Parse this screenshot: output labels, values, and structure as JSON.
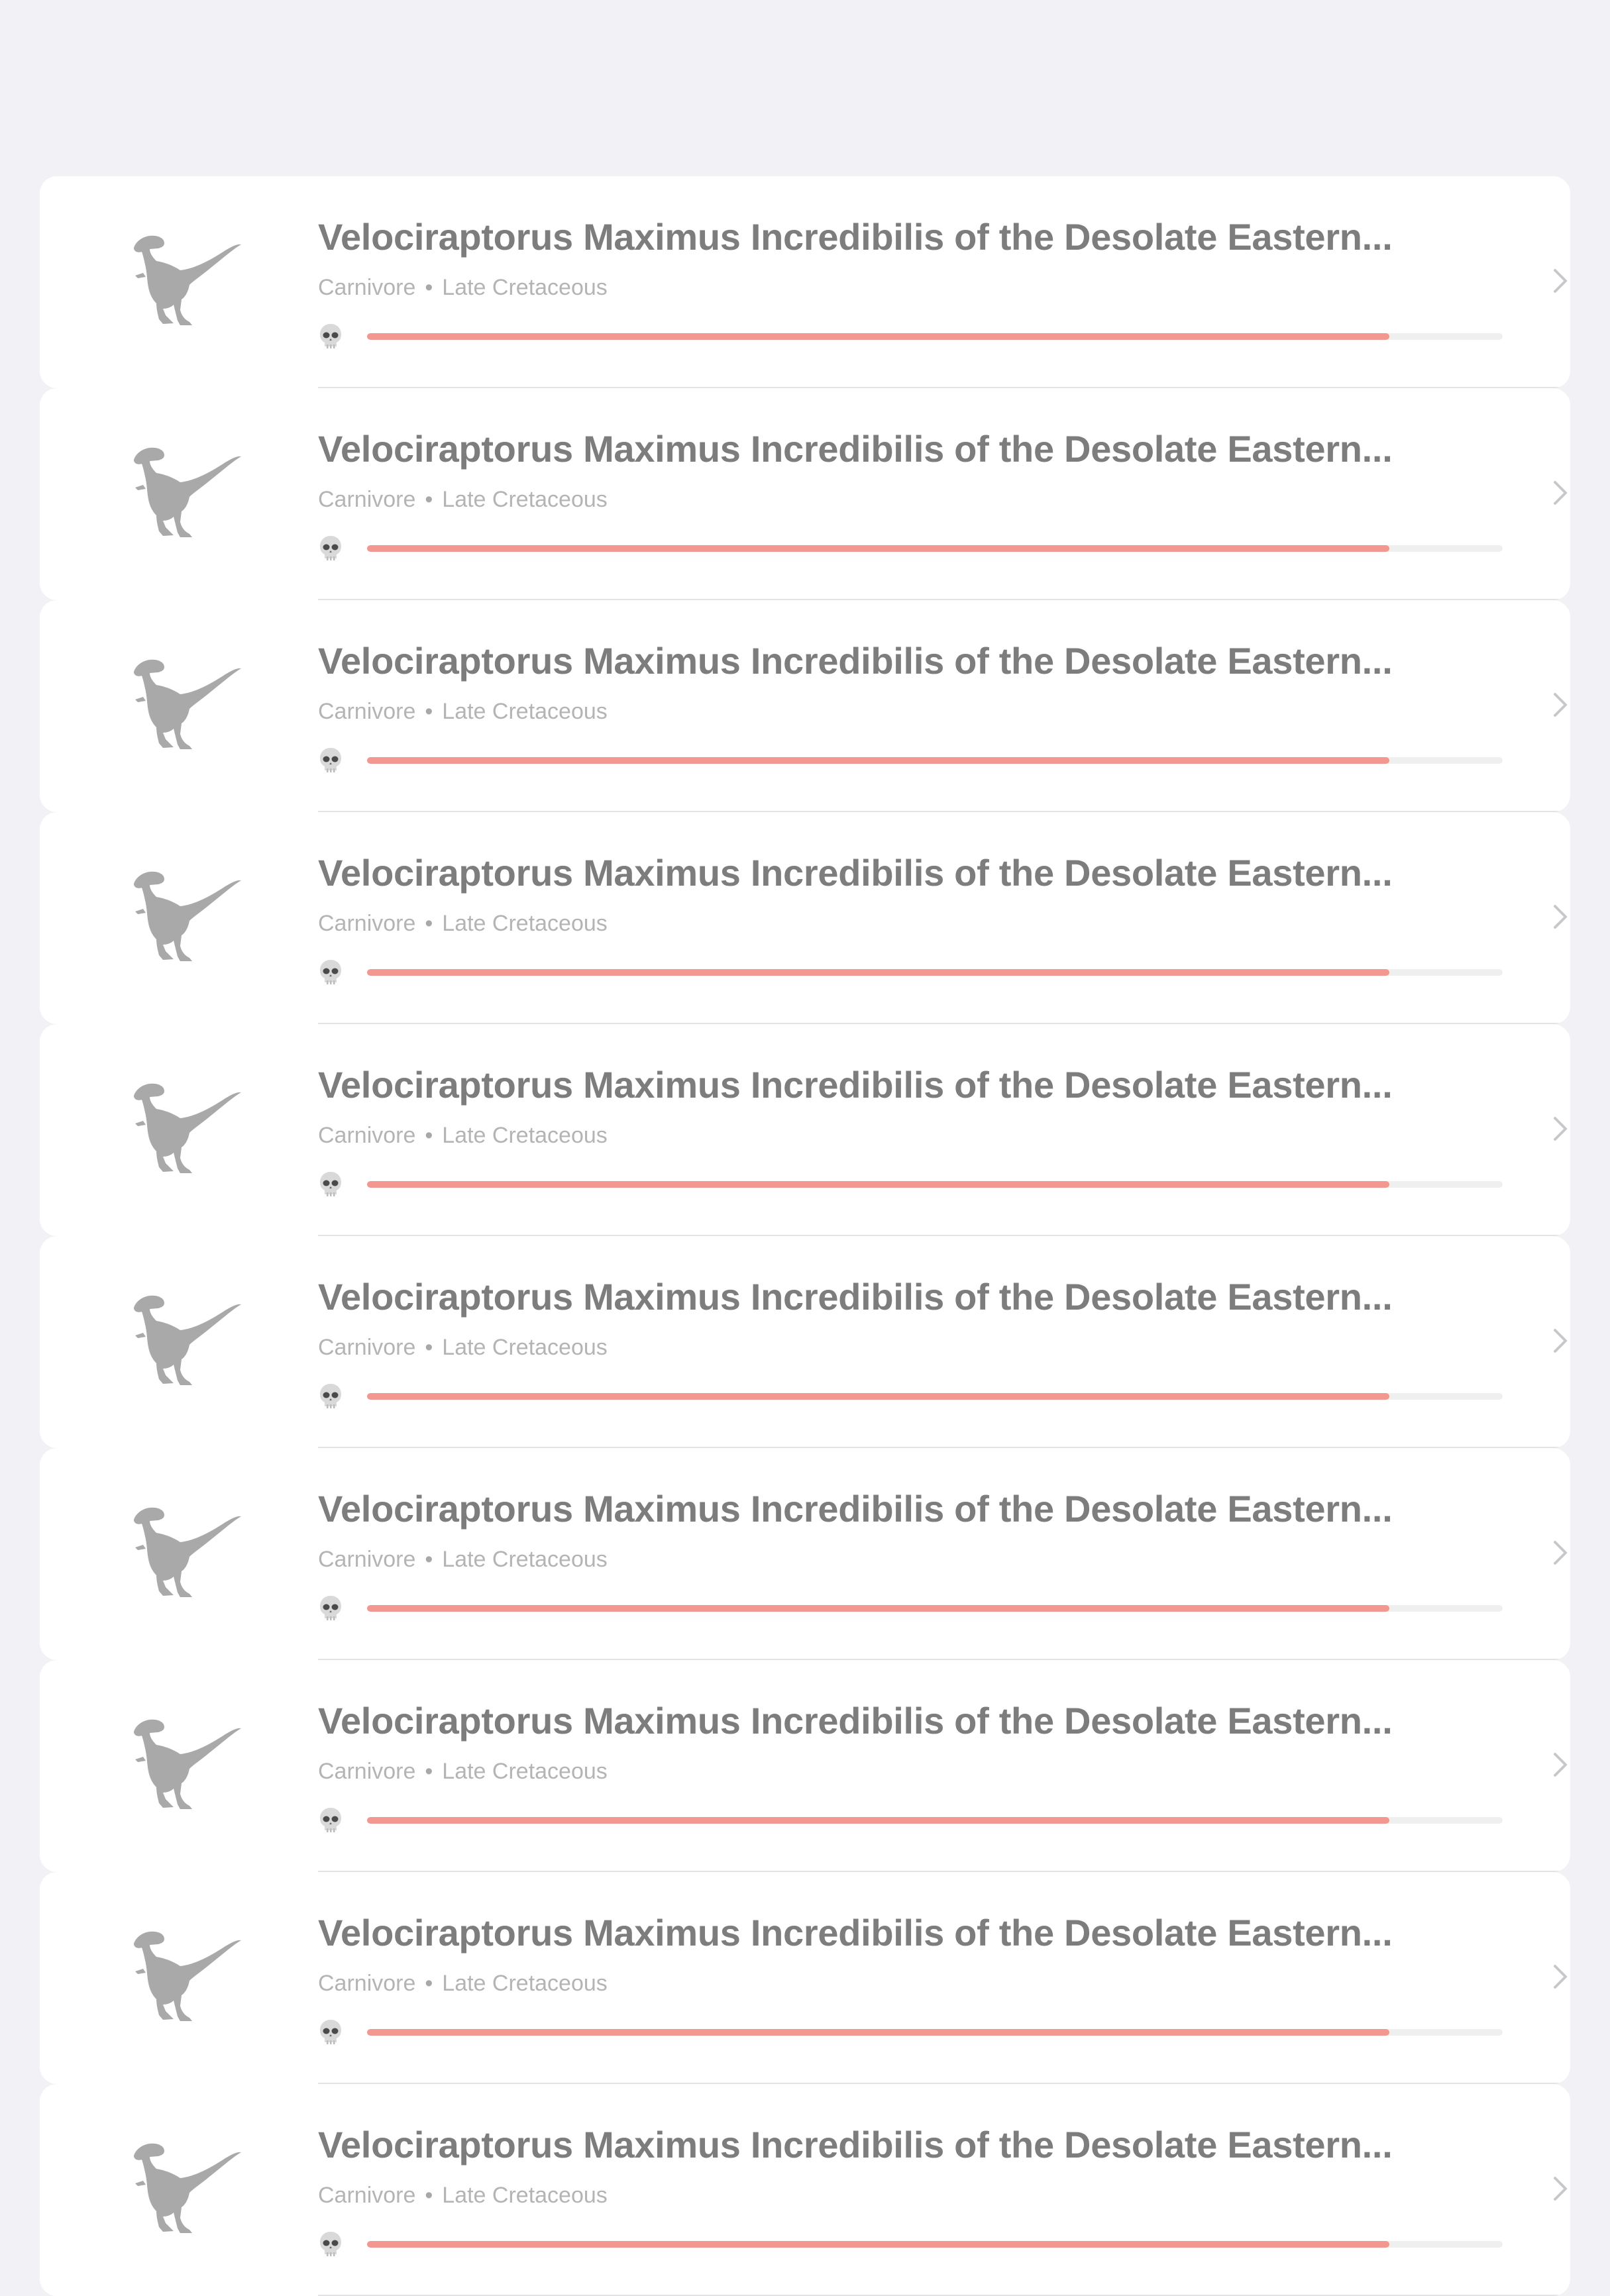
{
  "colors": {
    "background": "#f2f2f6",
    "card": "#ffffff",
    "title": "#7d7d7d",
    "meta": "#b4b4b4",
    "progress_fill": "#f29890",
    "progress_track": "#efefef",
    "icon": "#a9a9a9"
  },
  "list": {
    "items": [
      {
        "title": "Velociraptorus Maximus Incredibilis of the Desolate Eastern...",
        "diet": "Carnivore",
        "separator": "•",
        "period": "Late Cretaceous",
        "danger_fraction": 0.9,
        "thumbnail_icon": "raptor-icon",
        "danger_icon": "skull-icon",
        "disclosure_icon": "chevron-right-icon"
      },
      {
        "title": "Velociraptorus Maximus Incredibilis of the Desolate Eastern...",
        "diet": "Carnivore",
        "separator": "•",
        "period": "Late Cretaceous",
        "danger_fraction": 0.9,
        "thumbnail_icon": "raptor-icon",
        "danger_icon": "skull-icon",
        "disclosure_icon": "chevron-right-icon"
      },
      {
        "title": "Velociraptorus Maximus Incredibilis of the Desolate Eastern...",
        "diet": "Carnivore",
        "separator": "•",
        "period": "Late Cretaceous",
        "danger_fraction": 0.9,
        "thumbnail_icon": "raptor-icon",
        "danger_icon": "skull-icon",
        "disclosure_icon": "chevron-right-icon"
      },
      {
        "title": "Velociraptorus Maximus Incredibilis of the Desolate Eastern...",
        "diet": "Carnivore",
        "separator": "•",
        "period": "Late Cretaceous",
        "danger_fraction": 0.9,
        "thumbnail_icon": "raptor-icon",
        "danger_icon": "skull-icon",
        "disclosure_icon": "chevron-right-icon"
      },
      {
        "title": "Velociraptorus Maximus Incredibilis of the Desolate Eastern...",
        "diet": "Carnivore",
        "separator": "•",
        "period": "Late Cretaceous",
        "danger_fraction": 0.9,
        "thumbnail_icon": "raptor-icon",
        "danger_icon": "skull-icon",
        "disclosure_icon": "chevron-right-icon"
      },
      {
        "title": "Velociraptorus Maximus Incredibilis of the Desolate Eastern...",
        "diet": "Carnivore",
        "separator": "•",
        "period": "Late Cretaceous",
        "danger_fraction": 0.9,
        "thumbnail_icon": "raptor-icon",
        "danger_icon": "skull-icon",
        "disclosure_icon": "chevron-right-icon"
      },
      {
        "title": "Velociraptorus Maximus Incredibilis of the Desolate Eastern...",
        "diet": "Carnivore",
        "separator": "•",
        "period": "Late Cretaceous",
        "danger_fraction": 0.9,
        "thumbnail_icon": "raptor-icon",
        "danger_icon": "skull-icon",
        "disclosure_icon": "chevron-right-icon"
      },
      {
        "title": "Velociraptorus Maximus Incredibilis of the Desolate Eastern...",
        "diet": "Carnivore",
        "separator": "•",
        "period": "Late Cretaceous",
        "danger_fraction": 0.9,
        "thumbnail_icon": "raptor-icon",
        "danger_icon": "skull-icon",
        "disclosure_icon": "chevron-right-icon"
      },
      {
        "title": "Velociraptorus Maximus Incredibilis of the Desolate Eastern...",
        "diet": "Carnivore",
        "separator": "•",
        "period": "Late Cretaceous",
        "danger_fraction": 0.9,
        "thumbnail_icon": "raptor-icon",
        "danger_icon": "skull-icon",
        "disclosure_icon": "chevron-right-icon"
      },
      {
        "title": "Velociraptorus Maximus Incredibilis of the Desolate Eastern...",
        "diet": "Carnivore",
        "separator": "•",
        "period": "Late Cretaceous",
        "danger_fraction": 0.9,
        "thumbnail_icon": "raptor-icon",
        "danger_icon": "skull-icon",
        "disclosure_icon": "chevron-right-icon"
      }
    ]
  }
}
